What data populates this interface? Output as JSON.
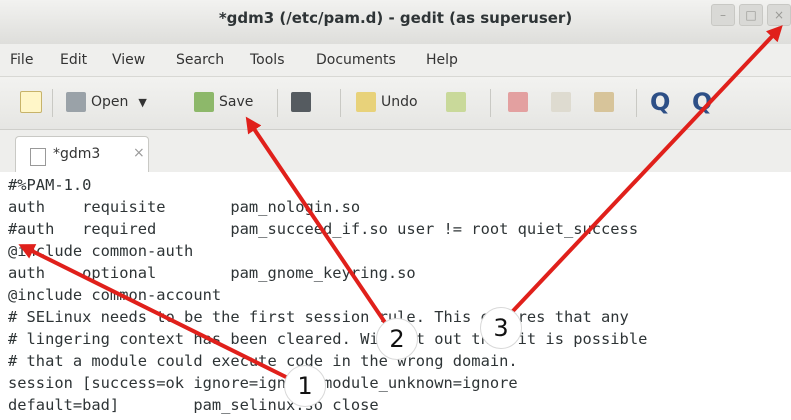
{
  "window": {
    "title": "*gdm3 (/etc/pam.d) - gedit (as superuser)"
  },
  "menu": [
    "File",
    "Edit",
    "View",
    "Search",
    "Tools",
    "Documents",
    "Help"
  ],
  "toolbar": {
    "open_label": "Open",
    "save_label": "Save",
    "undo_label": "Undo"
  },
  "tab": {
    "label": "*gdm3",
    "close": "×"
  },
  "editor": {
    "lines": [
      "#%PAM-1.0",
      "auth    requisite       pam_nologin.so",
      "#auth   required        pam_succeed_if.so user != root quiet_success",
      "@include common-auth",
      "auth    optional        pam_gnome_keyring.so",
      "@include common-account",
      "# SELinux needs to be the first session rule. This ensures that any",
      "# lingering context has been cleared. Without out this it is possible",
      "# that a module could execute code in the wrong domain.",
      "session [success=ok ignore=ignore module_unknown=ignore",
      "default=bad]        pam_selinux.so close"
    ]
  },
  "annotations": [
    "1",
    "2",
    "3"
  ],
  "colors": {
    "arrow": "#e0201b",
    "titlebar": "#e6e6e3",
    "editor_bg": "#ffffff"
  },
  "icons": [
    "new-document-icon",
    "open-icon",
    "save-icon",
    "print-icon",
    "undo-icon",
    "redo-icon",
    "cut-icon",
    "copy-icon",
    "paste-icon",
    "search-icon",
    "replace-icon"
  ]
}
